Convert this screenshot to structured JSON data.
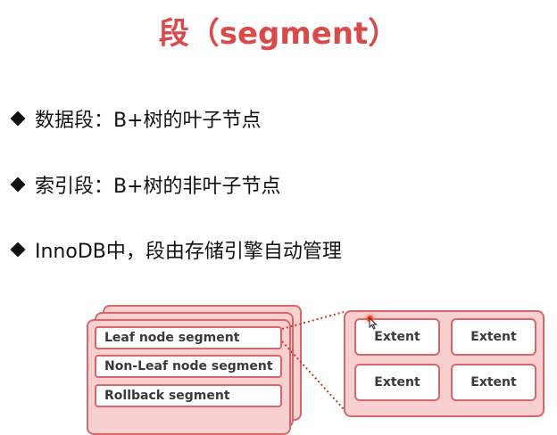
{
  "slide": {
    "title": "段（segment）",
    "bullets": [
      "数据段：B+树的叶子节点",
      "索引段：B+树的非叶子节点",
      "InnoDB中，段由存储引擎自动管理"
    ]
  },
  "diagram": {
    "segments": [
      "Leaf node segment",
      "Non-Leaf node segment",
      "Rollback segment"
    ],
    "extents": [
      "Extent",
      "Extent",
      "Extent",
      "Extent"
    ]
  },
  "colors": {
    "title": "#d94a4a",
    "border": "#d9666a",
    "fill": "#f8d0d0",
    "connector": "#c0392b"
  }
}
